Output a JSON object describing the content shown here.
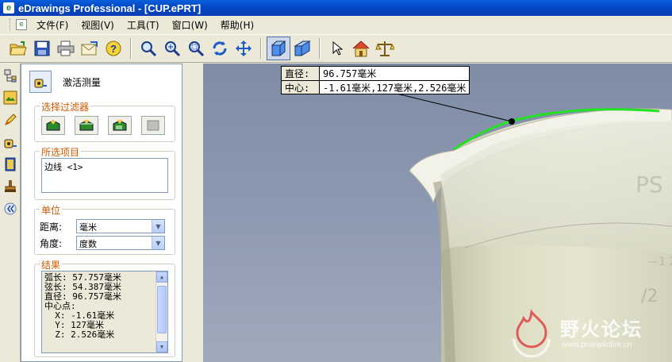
{
  "window": {
    "title": "eDrawings Professional - [CUP.ePRT]"
  },
  "menu": [
    "文件(F)",
    "视图(V)",
    "工具(T)",
    "窗口(W)",
    "帮助(H)"
  ],
  "toolbar_icons": [
    "open-icon",
    "save-icon",
    "print-icon",
    "mail-icon",
    "help-icon",
    "zoom-to-fit-icon",
    "zoom-in-out-icon",
    "zoom-to-area-icon",
    "rotate-icon",
    "pan-icon",
    "shaded-icon",
    "perspective-icon",
    "select-icon",
    "home-icon",
    "measure-scale-icon"
  ],
  "panel": {
    "activate_label": "激活测量",
    "filter_title": "选择过滤器",
    "selected_title": "所选项目",
    "selected_items": [
      "边线 <1>"
    ],
    "unit_title": "单位",
    "distance_label": "距离:",
    "distance_value": "毫米",
    "angle_label": "角度:",
    "angle_value": "度数",
    "result_title": "结果",
    "results": [
      "弧长: 57.757毫米",
      "弦长: 54.387毫米",
      "直径: 96.757毫米",
      "中心点:",
      "  X: -1.61毫米",
      "  Y: 127毫米",
      "  Z: 2.526毫米"
    ]
  },
  "readout": {
    "diameter_label": "直径:",
    "diameter_value": "96.757毫米",
    "center_label": "中心:",
    "center_value": "-1.61毫米,127毫米,2.526毫米"
  },
  "watermark": {
    "title": "野火论坛",
    "url": "www.proewildfire.cn"
  },
  "colors": {
    "accent_orange": "#d25a00",
    "highlight_edge": "#22e222",
    "title_blue": "#0a5fdc"
  }
}
